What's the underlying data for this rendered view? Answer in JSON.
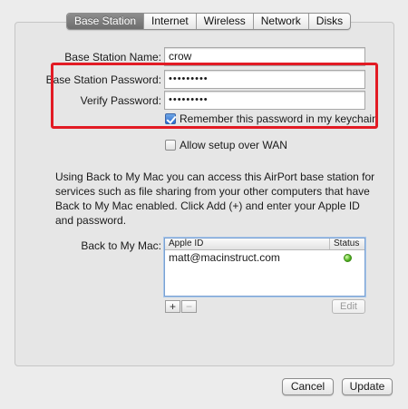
{
  "tabs": [
    "Base Station",
    "Internet",
    "Wireless",
    "Network",
    "Disks"
  ],
  "form": {
    "name_label": "Base Station Name:",
    "name_value": "crow",
    "password_label": "Base Station Password:",
    "password_value": "•••••••••",
    "verify_label": "Verify Password:",
    "verify_value": "•••••••••",
    "remember_label": "Remember this password in my keychain",
    "wan_label": "Allow setup over WAN"
  },
  "info_text": "Using Back to My Mac you can access this AirPort base station for services such as file sharing from your other computers that have Back to My Mac enabled. Click Add (+) and enter your Apple ID and password.",
  "btmm": {
    "label": "Back to My Mac:",
    "col_id": "Apple ID",
    "col_status": "Status",
    "rows": [
      {
        "apple_id": "matt@macinstruct.com",
        "status": "green"
      }
    ],
    "add_label": "+",
    "remove_label": "−",
    "edit_label": "Edit"
  },
  "buttons": {
    "cancel": "Cancel",
    "update": "Update"
  },
  "colors": {
    "highlight": "#e21b24",
    "status_ok": "#4fb21e"
  }
}
